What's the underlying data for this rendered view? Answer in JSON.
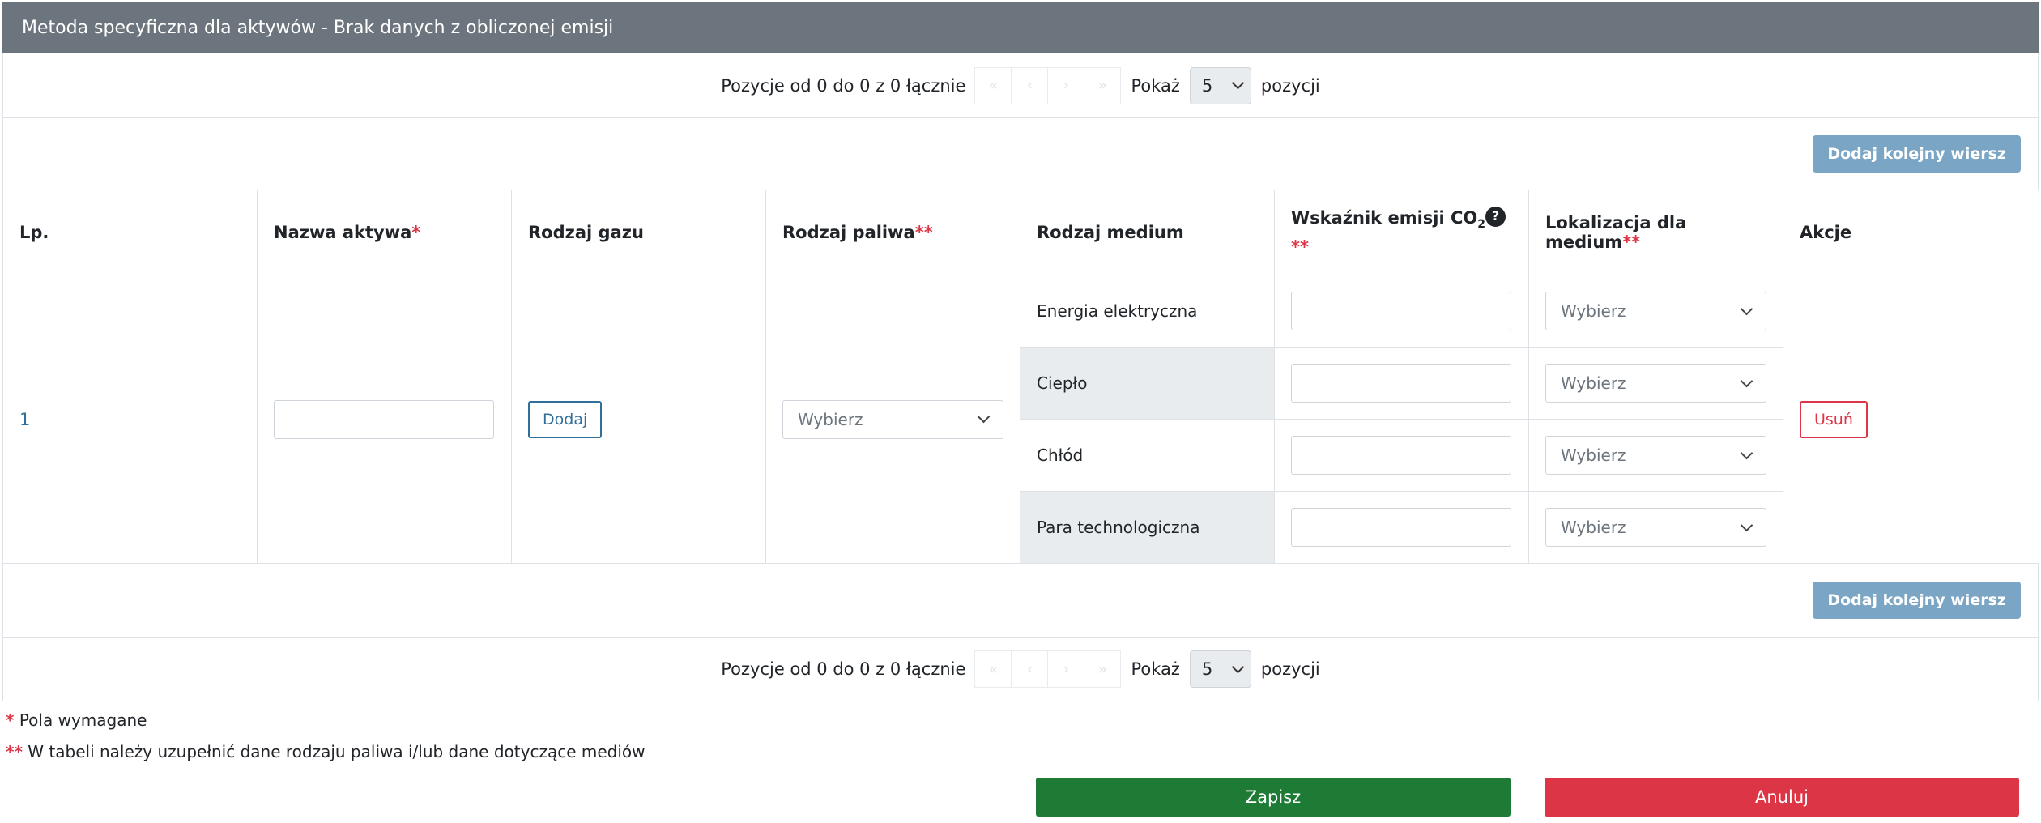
{
  "header": {
    "title": "Metoda specyficzna dla aktywów - Brak danych z obliczonej emisji"
  },
  "pager": {
    "info": "Pozycje od 0 do 0 z 0 łącznie",
    "show_label": "Pokaż",
    "page_size": "5",
    "suffix": "pozycji",
    "first": "«",
    "prev": "‹",
    "next": "›",
    "last": "»"
  },
  "actions": {
    "add_row_label": "Dodaj kolejny wiersz"
  },
  "table": {
    "headers": {
      "lp": "Lp.",
      "asset_name": "Nazwa aktywa",
      "gas_type": "Rodzaj gazu",
      "fuel_type": "Rodzaj paliwa",
      "medium_type": "Rodzaj medium",
      "emission_factor": "Wskaźnik emisji CO",
      "emission_factor_sub": "2",
      "medium_location": "Lokalizacja dla medium",
      "actions": "Akcje"
    },
    "required_single": "*",
    "required_double": "**",
    "help_icon": "?",
    "row": {
      "lp": "1",
      "gas_add_label": "Dodaj",
      "fuel_placeholder": "Wybierz",
      "remove_label": "Usuń",
      "media": [
        {
          "name": "Energia elektryczna",
          "location": "Wybierz"
        },
        {
          "name": "Ciepło",
          "location": "Wybierz"
        },
        {
          "name": "Chłód",
          "location": "Wybierz"
        },
        {
          "name": "Para technologiczna",
          "location": "Wybierz"
        }
      ]
    }
  },
  "notes": {
    "required_marker": "*",
    "required_text": "Pola wymagane",
    "double_marker": "**",
    "double_text": "W tabeli należy uzupełnić dane rodzaju paliwa i/lub dane dotyczące mediów"
  },
  "footer": {
    "save_label": "Zapisz",
    "cancel_label": "Anuluj"
  }
}
